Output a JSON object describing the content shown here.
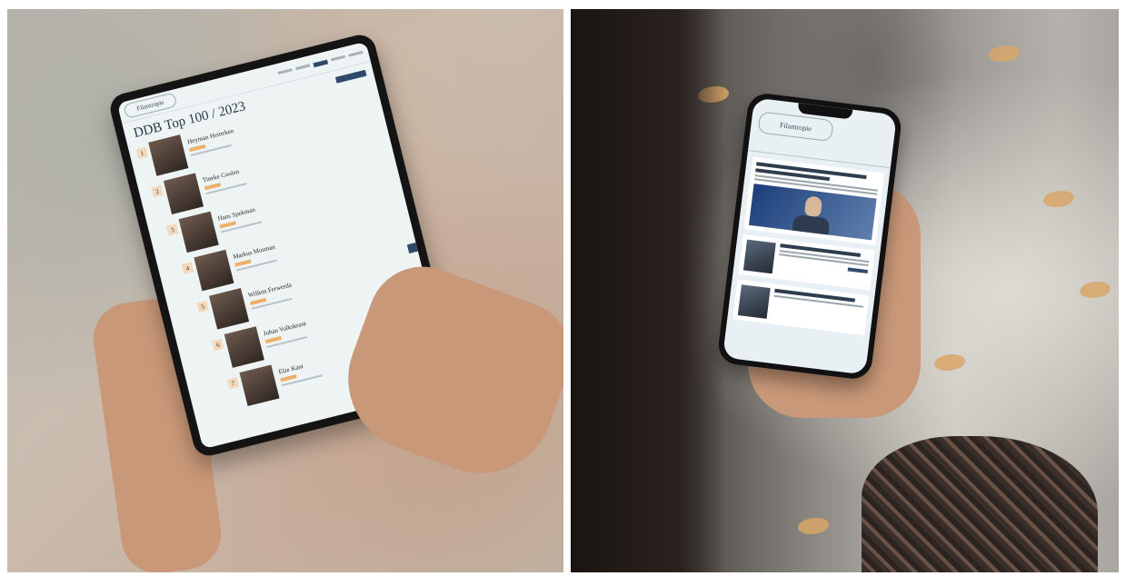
{
  "tablet": {
    "logo": "Filantropie",
    "page_title": "DDB Top 100 / 2023",
    "list": [
      {
        "rank": "1",
        "name": "Heyman Heineken"
      },
      {
        "rank": "2",
        "name": "Tineke Coolen"
      },
      {
        "rank": "3",
        "name": "Hans Spekman"
      },
      {
        "rank": "4",
        "name": "Markus Mosman"
      },
      {
        "rank": "5",
        "name": "Willem Ferwerda"
      },
      {
        "rank": "6",
        "name": "Johan Volkskrant"
      },
      {
        "rank": "7",
        "name": "Elze Kant"
      }
    ]
  },
  "phone": {
    "logo": "Filantropie"
  },
  "colors": {
    "accent": "#2f4a6b",
    "tag": "#efb06a",
    "rank_badge": "#f2d9b9",
    "screen_bg": "#eef3f4"
  }
}
